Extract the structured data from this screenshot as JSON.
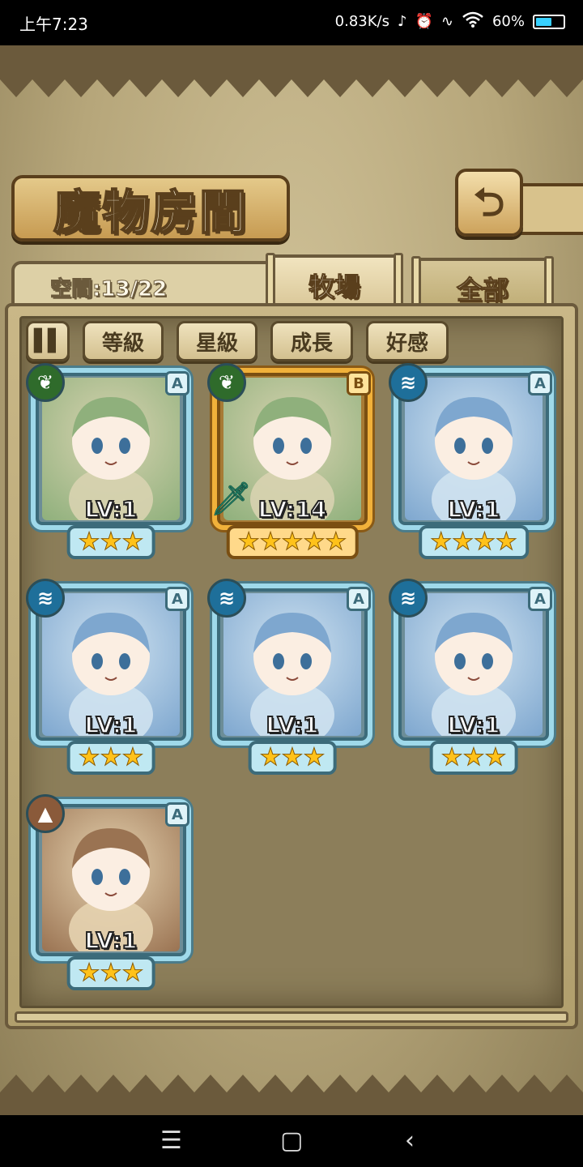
{
  "status_bar": {
    "time": "上午7:23",
    "network_speed": "0.83K/s",
    "battery_percent": "60%",
    "battery_level": 0.6
  },
  "header": {
    "title": "魔物房間",
    "back_icon": "return-arrow-icon"
  },
  "space": {
    "label": "空間:13/22"
  },
  "tabs": [
    {
      "label": "牧場",
      "active": true
    },
    {
      "label": "全部",
      "active": false
    }
  ],
  "filters": {
    "pause_icon": "pause-sort-icon",
    "buttons": [
      "等級",
      "星級",
      "成長",
      "好感"
    ]
  },
  "cards": [
    {
      "level": "LV:1",
      "rank": "A",
      "element": "grass",
      "stars": 3,
      "frame": "blue"
    },
    {
      "level": "LV:14",
      "rank": "B",
      "element": "grass",
      "stars": 5,
      "frame": "gold",
      "weapon": "sword-icon"
    },
    {
      "level": "LV:1",
      "rank": "A",
      "element": "water",
      "stars": 4,
      "frame": "blue"
    },
    {
      "level": "LV:1",
      "rank": "A",
      "element": "water",
      "stars": 3,
      "frame": "blue"
    },
    {
      "level": "LV:1",
      "rank": "A",
      "element": "water",
      "stars": 3,
      "frame": "blue"
    },
    {
      "level": "LV:1",
      "rank": "A",
      "element": "water",
      "stars": 3,
      "frame": "blue"
    },
    {
      "level": "LV:1",
      "rank": "A",
      "element": "earth",
      "stars": 3,
      "frame": "blue"
    }
  ],
  "nav": {
    "menu_icon": "menu-icon",
    "home_icon": "home-square-icon",
    "back_icon": "back-chevron-icon"
  }
}
